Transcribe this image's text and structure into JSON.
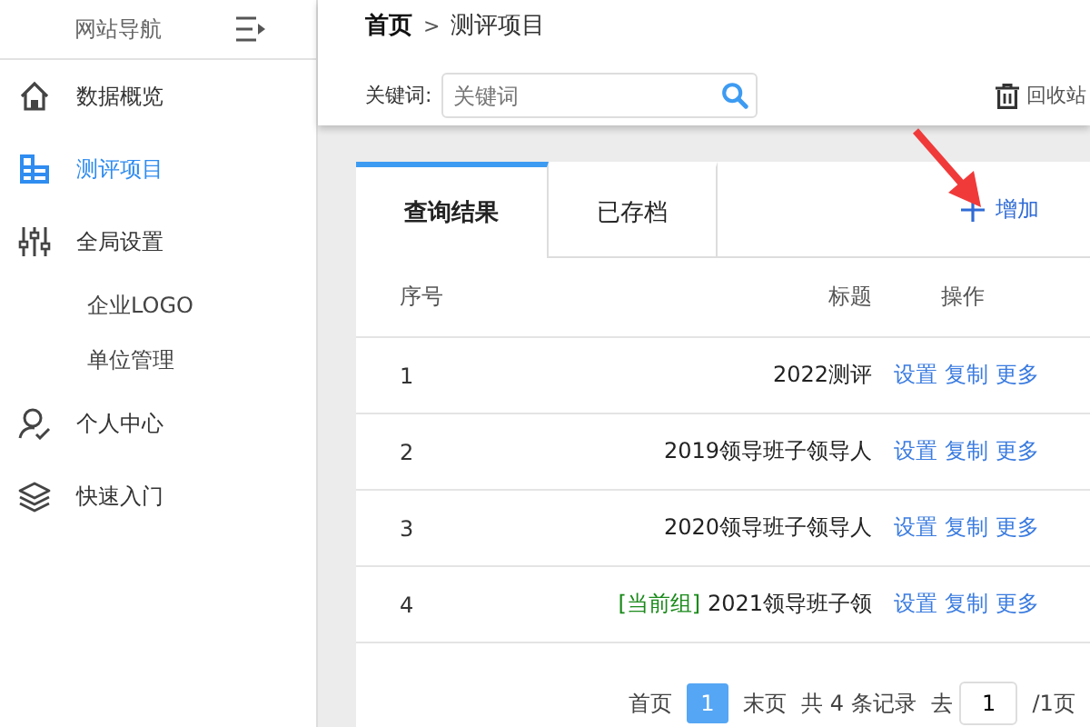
{
  "sidebar": {
    "title": "网站导航",
    "items": [
      {
        "label": "数据概览",
        "selected": false
      },
      {
        "label": "测评项目",
        "selected": true
      },
      {
        "label": "全局设置",
        "selected": false,
        "children": [
          {
            "label": "企业LOGO"
          },
          {
            "label": "单位管理"
          }
        ]
      },
      {
        "label": "个人中心",
        "selected": false
      },
      {
        "label": "快速入门",
        "selected": false
      }
    ]
  },
  "breadcrumb": {
    "separator": ">",
    "items": [
      "首页",
      "测评项目"
    ]
  },
  "search": {
    "label": "关键词:",
    "placeholder": "关键词"
  },
  "recycle_button": "回收站",
  "tabs": [
    {
      "label": "查询结果",
      "selected": true
    },
    {
      "label": "已存档",
      "selected": false
    }
  ],
  "add_button": "增加",
  "table": {
    "columns": [
      "序号",
      "标题",
      "操作"
    ],
    "rows": [
      {
        "index": "1",
        "title": "2022测评",
        "actions": [
          "设置",
          "复制",
          "更多"
        ]
      },
      {
        "index": "2",
        "title": "2019领导班子领导人",
        "actions": [
          "设置",
          "复制",
          "更多"
        ]
      },
      {
        "index": "3",
        "title": "2020领导班子领导人",
        "actions": [
          "设置",
          "复制",
          "更多"
        ]
      },
      {
        "index": "4",
        "tag": "[当前组]",
        "title": "2021领导班子领",
        "actions": [
          "设置",
          "复制",
          "更多"
        ]
      }
    ]
  },
  "pagination": {
    "first": "首页",
    "pages": [
      {
        "label": "1",
        "selected": true
      }
    ],
    "last": "末页",
    "total": "共 4 条记录",
    "goto": "去",
    "goto_value": "1",
    "page_count": "/1页"
  }
}
